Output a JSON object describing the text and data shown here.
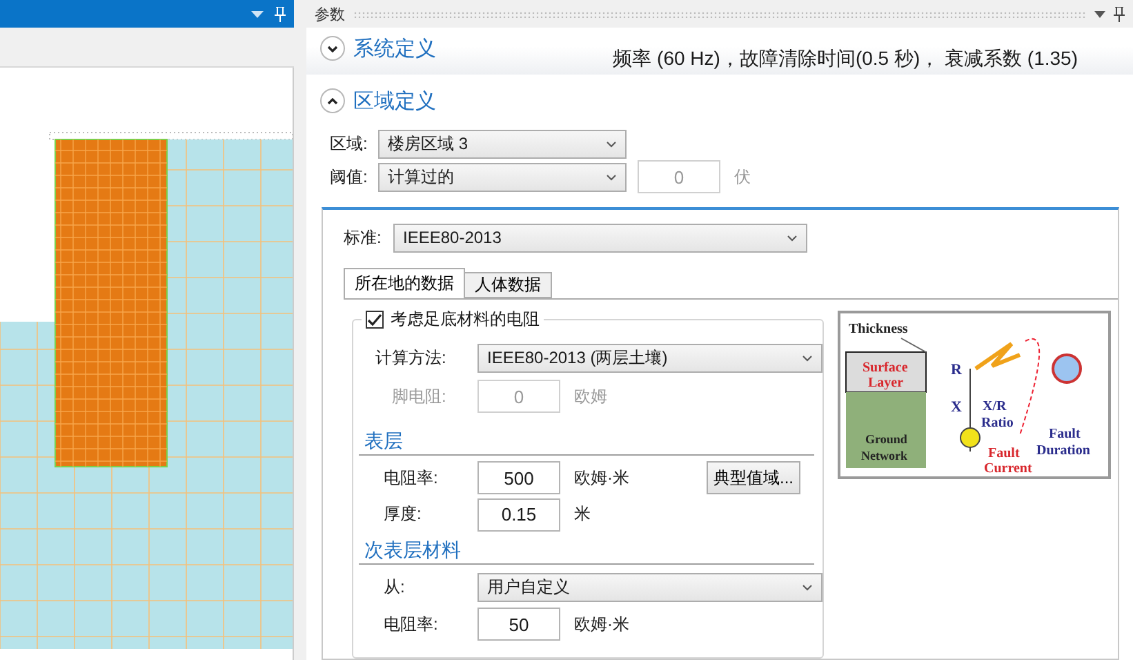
{
  "left_pane": {
    "has_menu": true,
    "pinned": true
  },
  "parameters_panel": {
    "title": "参数",
    "sections": [
      {
        "title": "系统定义",
        "expanded": false,
        "summary": "频率 (60 Hz)，故障清除时间(0.5 秒)， 衰减系数 (1.35)"
      },
      {
        "title": "区域定义",
        "expanded": true
      }
    ],
    "region": {
      "label": "区域:",
      "value": "楼房区域 3"
    },
    "threshold": {
      "label": "阈值:",
      "value": "计算过的",
      "input": "0",
      "input_disabled": true,
      "unit": "伏"
    },
    "standard": {
      "label": "标准:",
      "value": "IEEE80-2013"
    },
    "tabs": [
      {
        "label": "所在地的数据",
        "selected": true
      },
      {
        "label": "人体数据",
        "selected": false
      }
    ],
    "surface_material": {
      "checkbox": {
        "label": "考虑足底材料的电阻",
        "checked": true
      },
      "method": {
        "label": "计算方法:",
        "value": "IEEE80-2013 (两层土壤)"
      },
      "foot_resistance": {
        "label": "脚电阻:",
        "value": "0",
        "unit": "欧姆",
        "disabled": true
      },
      "surface_heading": "表层",
      "resistivity": {
        "label": "电阻率:",
        "value": "500",
        "unit": "欧姆·米"
      },
      "typical_button": "典型值域...",
      "thickness": {
        "label": "厚度:",
        "value": "0.15",
        "unit": "米"
      },
      "sublayer_heading": "次表层材料",
      "source": {
        "label": "从:",
        "value": "用户自定义"
      },
      "sublayer_resistivity": {
        "label": "电阻率:",
        "value": "50",
        "unit": "欧姆·米"
      }
    },
    "diagram": {
      "labels": [
        {
          "text": "Thickness",
          "kind": "dark"
        },
        {
          "text": "Surface",
          "kind": "red"
        },
        {
          "text": "Layer",
          "kind": "red"
        },
        {
          "text": "Ground",
          "kind": "dark"
        },
        {
          "text": "Network",
          "kind": "dark"
        },
        {
          "text": "R",
          "kind": "navy"
        },
        {
          "text": "X",
          "kind": "navy"
        },
        {
          "text": "X/R",
          "kind": "navy"
        },
        {
          "text": "Ratio",
          "kind": "navy"
        },
        {
          "text": "Fault",
          "kind": "navy"
        },
        {
          "text": "Fault",
          "kind": "red"
        },
        {
          "text": "Duration",
          "kind": "navy"
        },
        {
          "text": "Current",
          "kind": "red"
        }
      ]
    }
  }
}
